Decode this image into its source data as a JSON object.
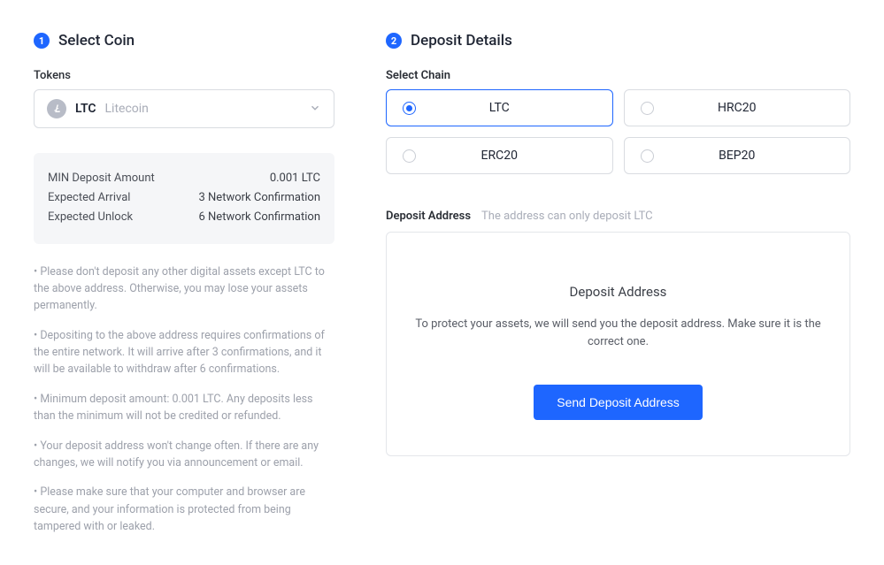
{
  "left": {
    "step_number": "1",
    "step_title": "Select Coin",
    "tokens_label": "Tokens",
    "selected": {
      "symbol": "LTC",
      "name": "Litecoin"
    },
    "info": {
      "min_label": "MIN Deposit Amount",
      "min_value": "0.001 LTC",
      "arrival_label": "Expected Arrival",
      "arrival_value": "3 Network Confirmation",
      "unlock_label": "Expected Unlock",
      "unlock_value": "6 Network Confirmation"
    },
    "notes": {
      "n1": "• Please don't deposit any other digital assets except LTC to the above address. Otherwise, you may lose your assets permanently.",
      "n2": "• Depositing to the above address requires confirmations of the entire network. It will arrive after 3 confirmations, and it will be available to withdraw after 6 confirmations.",
      "n3": "• Minimum deposit amount: 0.001 LTC. Any deposits less than the minimum will not be credited or refunded.",
      "n4": "• Your deposit address won't change often. If there are any changes, we will notify you via announcement or email.",
      "n5": "• Please make sure that your computer and browser are secure, and your information is protected from being tampered with or leaked."
    }
  },
  "right": {
    "step_number": "2",
    "step_title": "Deposit Details",
    "chain_label": "Select Chain",
    "chains": {
      "c1": "LTC",
      "c2": "HRC20",
      "c3": "ERC20",
      "c4": "BEP20"
    },
    "address": {
      "label": "Deposit Address",
      "hint": "The address can only deposit LTC",
      "box_title": "Deposit Address",
      "box_desc": "To protect your assets, we will send you the deposit address. Make sure it is the correct one.",
      "button": "Send Deposit Address"
    }
  }
}
